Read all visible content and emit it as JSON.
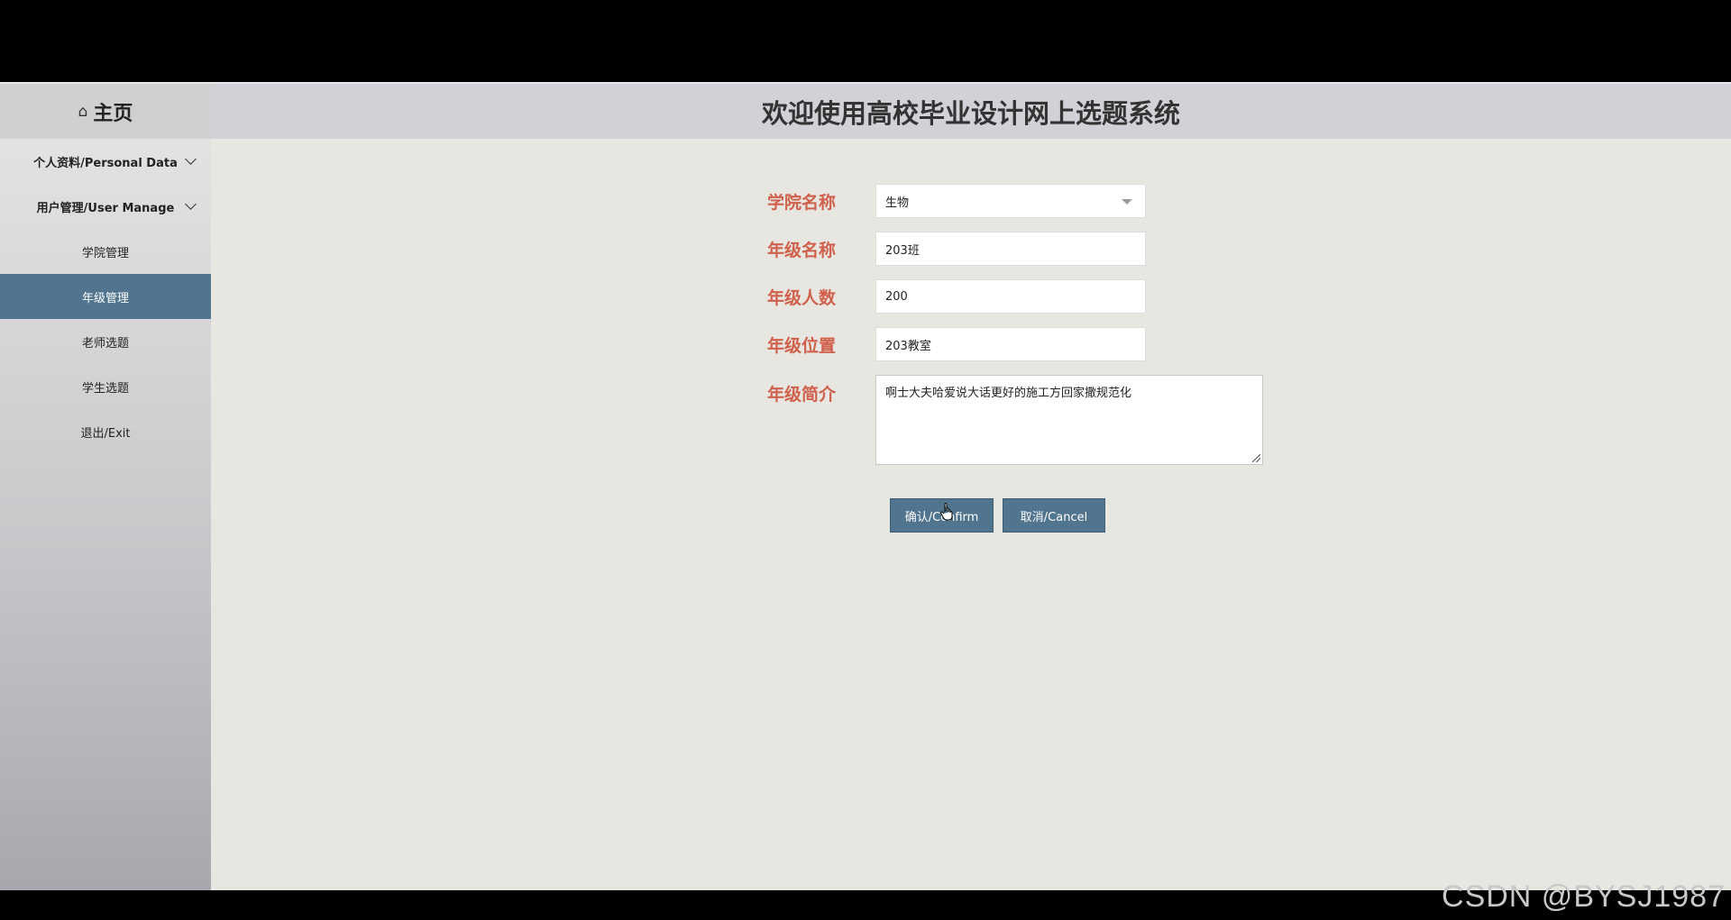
{
  "sidebar": {
    "home_icon": "home-icon",
    "home_label": "主页",
    "groups": [
      {
        "label": "个人资料/Personal Data"
      },
      {
        "label": "用户管理/User Manage"
      }
    ],
    "items": [
      {
        "label": "学院管理"
      },
      {
        "label": "年级管理"
      },
      {
        "label": "老师选题"
      },
      {
        "label": "学生选题"
      },
      {
        "label": "退出/Exit"
      }
    ],
    "active_item": "年级管理",
    "active_color": "#51758f"
  },
  "header": {
    "title": "欢迎使用高校毕业设计网上选题系统"
  },
  "form": {
    "college": {
      "label": "学院名称",
      "value": "生物"
    },
    "grade_name": {
      "label": "年级名称",
      "value": "203班"
    },
    "grade_count": {
      "label": "年级人数",
      "value": "200"
    },
    "grade_location": {
      "label": "年级位置",
      "value": "203教室"
    },
    "grade_intro": {
      "label": "年级简介",
      "value": "啊士大夫哈爱说大话更好的施工方回家撒规范化"
    },
    "label_color": "#d05f4b"
  },
  "buttons": {
    "confirm": "确认/Confirm",
    "cancel": "取消/Cancel"
  },
  "watermark": "CSDN @BYSJ1987"
}
